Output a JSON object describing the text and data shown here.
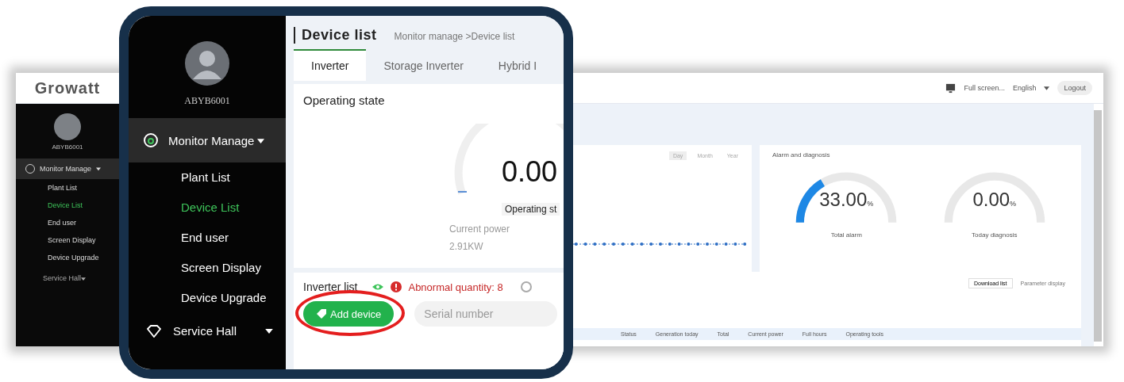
{
  "background_app": {
    "logo": "Growatt",
    "sidebar": {
      "user": "ABYB6001",
      "group": {
        "label": "Monitor Manage",
        "expanded": true
      },
      "items": [
        {
          "label": "Plant List",
          "selected": false
        },
        {
          "label": "Device List",
          "selected": true
        },
        {
          "label": "End user",
          "selected": false
        },
        {
          "label": "Screen Display",
          "selected": false
        },
        {
          "label": "Device Upgrade",
          "selected": false
        }
      ],
      "service": "Service Hall"
    },
    "header": {
      "fullscreen": "Full screen...",
      "language": "English",
      "logout": "Logout"
    },
    "chart_card": {
      "periods": [
        {
          "label": "Day",
          "selected": true
        },
        {
          "label": "Month",
          "selected": false
        },
        {
          "label": "Year",
          "selected": false
        }
      ]
    },
    "alarm_card": {
      "title": "Alarm and diagnosis",
      "gauges": [
        {
          "value": "33.00",
          "unit": "%",
          "label": "Total alarm"
        },
        {
          "value": "0.00",
          "unit": "%",
          "label": "Today diagnosis"
        }
      ]
    },
    "list": {
      "download": "Download list",
      "parameter": "Parameter display",
      "columns": [
        "Status",
        "Generation today",
        "Total",
        "Current power",
        "Full hours",
        "Operating tools"
      ]
    }
  },
  "callout": {
    "sidebar": {
      "user": "ABYB6001",
      "group": {
        "label": "Monitor Manage",
        "expanded": true
      },
      "items": [
        {
          "label": "Plant List",
          "selected": false
        },
        {
          "label": "Device List",
          "selected": true
        },
        {
          "label": "End user",
          "selected": false
        },
        {
          "label": "Screen Display",
          "selected": false
        },
        {
          "label": "Device Upgrade",
          "selected": false
        }
      ],
      "service": "Service Hall"
    },
    "title": "Device list",
    "breadcrumb": "Monitor manage >Device list",
    "tabs": [
      {
        "label": "Inverter",
        "selected": true
      },
      {
        "label": "Storage Inverter",
        "selected": false
      },
      {
        "label": "Hybrid I",
        "selected": false
      }
    ],
    "operating": {
      "title": "Operating state",
      "value": "0.00",
      "label": "Operating st",
      "power_label": "Current power",
      "power": "2.91KW"
    },
    "list": {
      "title": "Inverter list",
      "abnormal": "Abnormal quantity: 8",
      "add_button": "Add device",
      "search": {
        "placeholder": "Serial number"
      },
      "highlighted": true
    }
  }
}
